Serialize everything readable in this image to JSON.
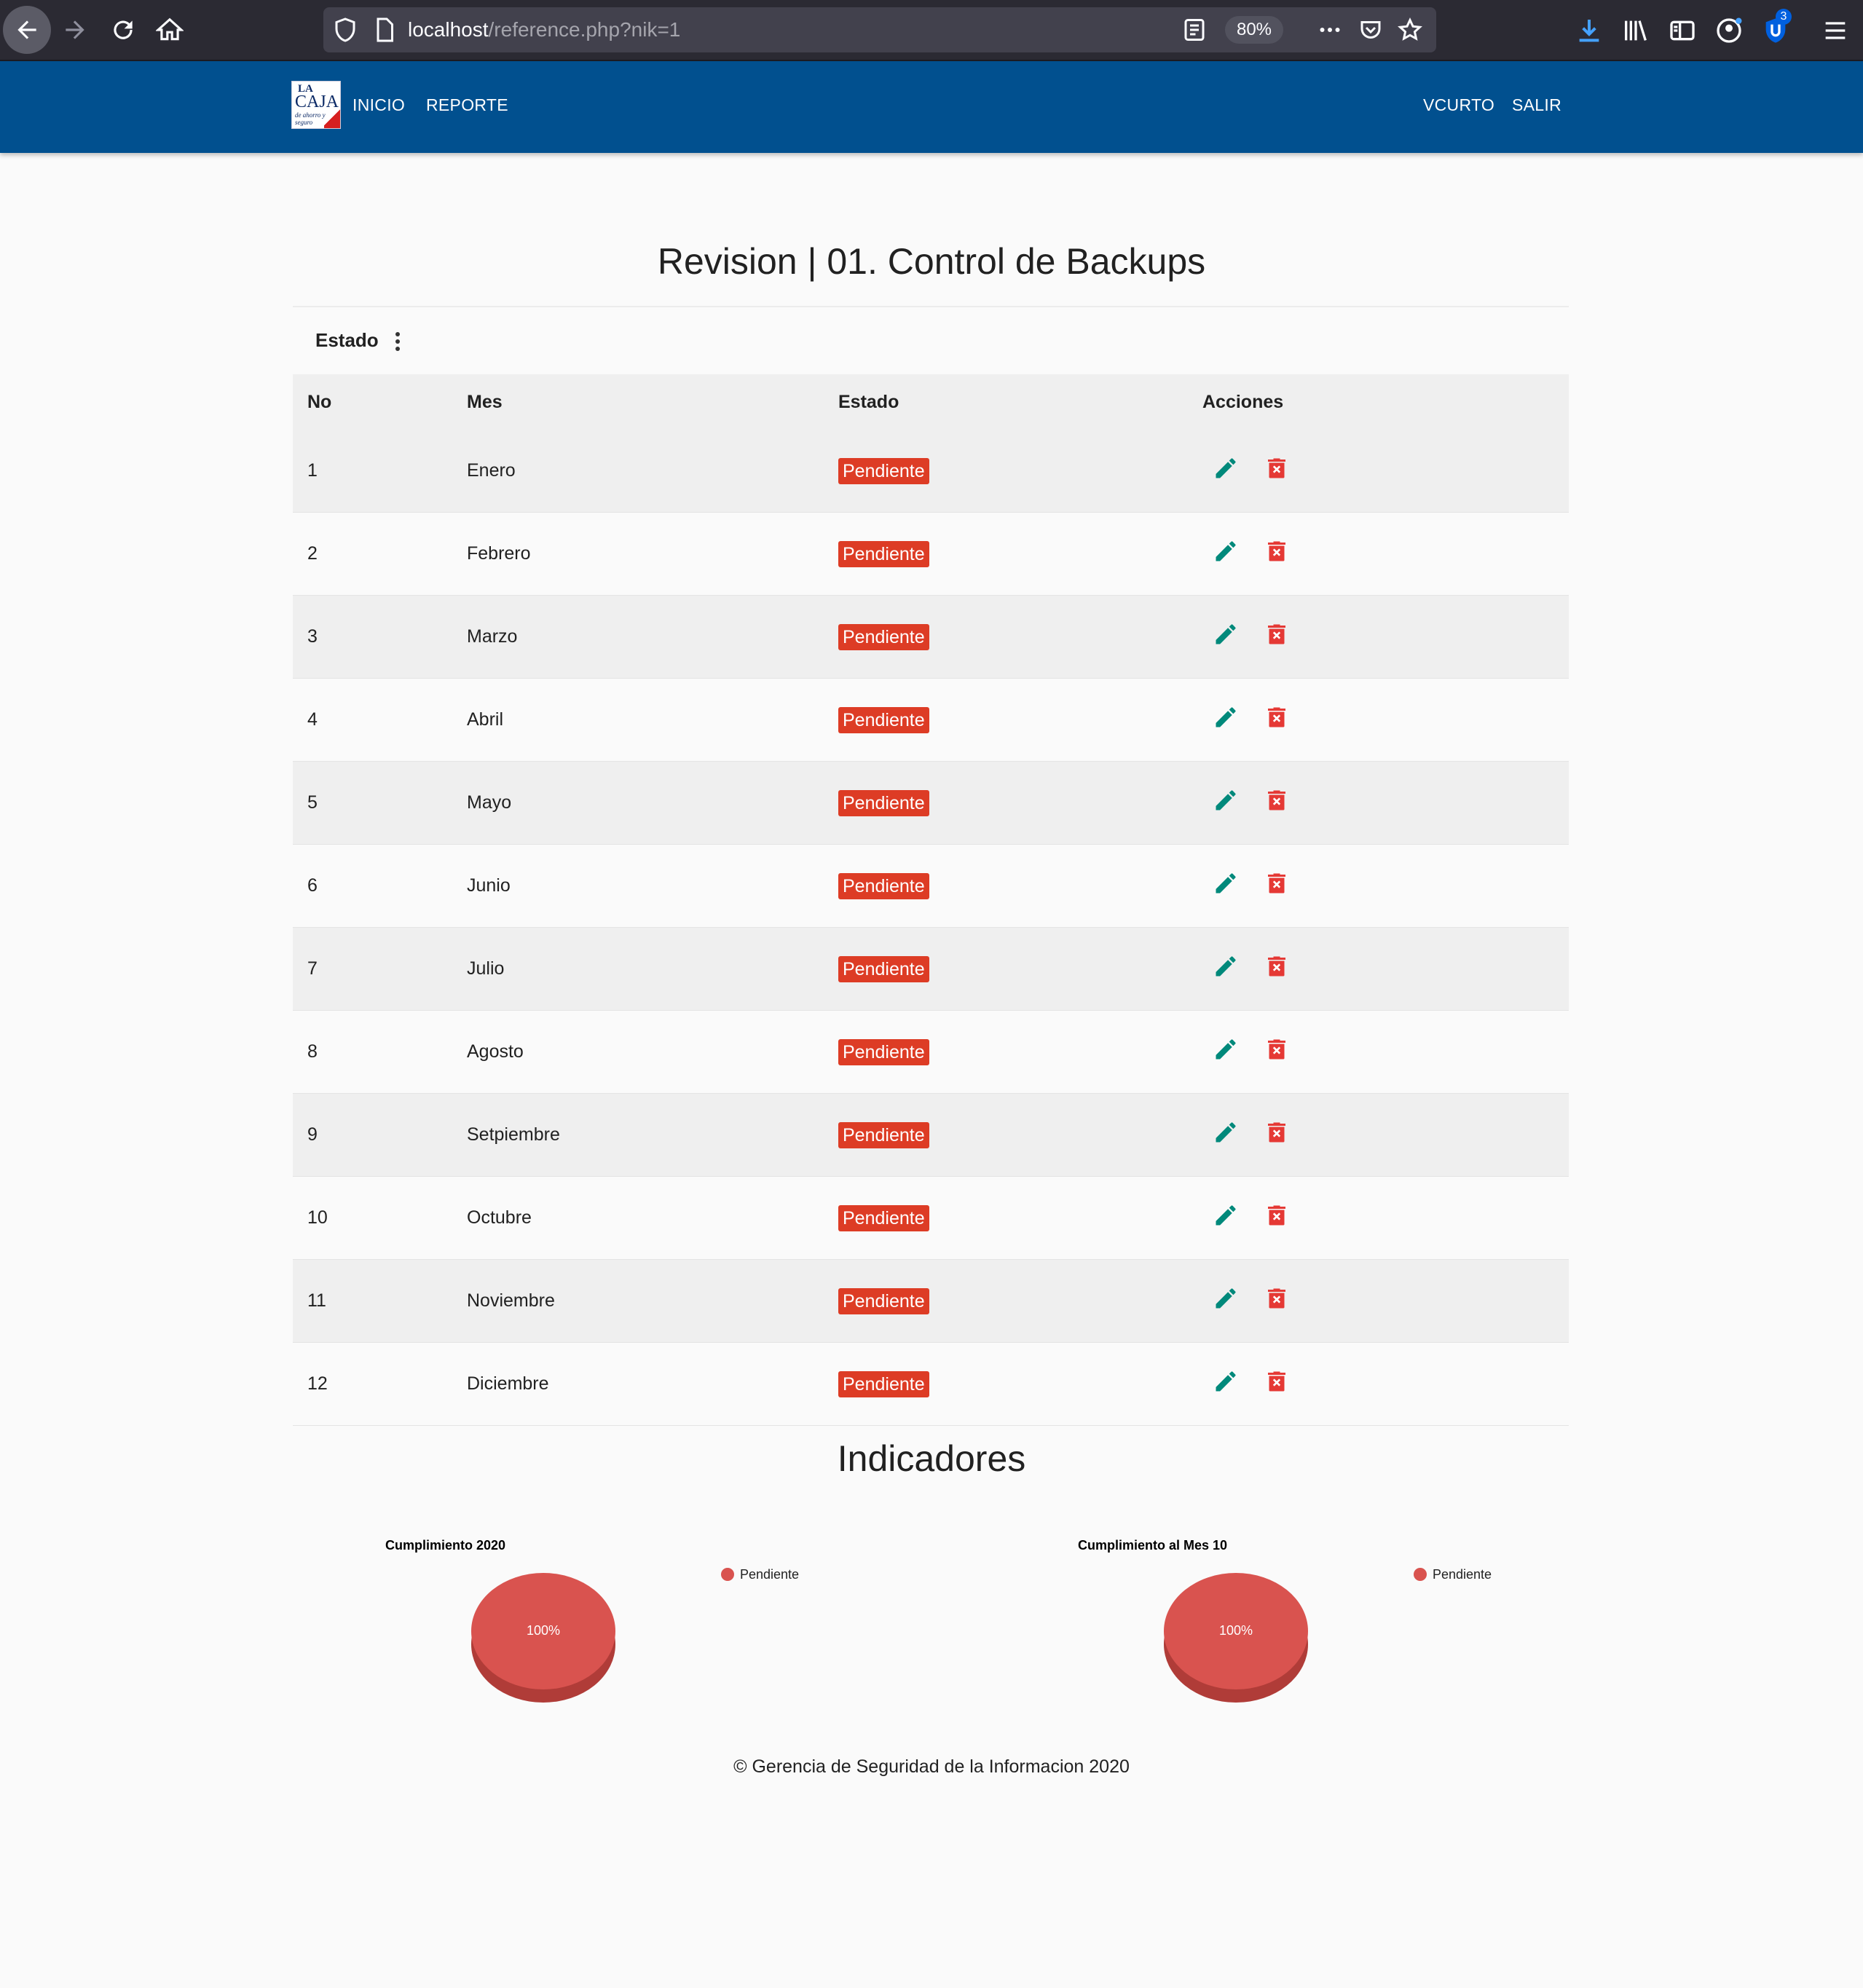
{
  "browser": {
    "url_host": "localhost",
    "url_path": "/reference.php?nik=1",
    "zoom": "80%",
    "notification_count": "3"
  },
  "nav": {
    "logo": {
      "line1": "LA",
      "line2": "CAJA",
      "line3": "de ahorro y seguro"
    },
    "links": [
      "INICIO",
      "REPORTE"
    ],
    "user": "VCURTO",
    "logout": "SALIR"
  },
  "page": {
    "title": "Revision | 01. Control de Backups",
    "filter_label": "Estado",
    "table": {
      "headers": [
        "No",
        "Mes",
        "Estado",
        "Acciones"
      ],
      "rows": [
        {
          "no": "1",
          "mes": "Enero",
          "estado": "Pendiente"
        },
        {
          "no": "2",
          "mes": "Febrero",
          "estado": "Pendiente"
        },
        {
          "no": "3",
          "mes": "Marzo",
          "estado": "Pendiente"
        },
        {
          "no": "4",
          "mes": "Abril",
          "estado": "Pendiente"
        },
        {
          "no": "5",
          "mes": "Mayo",
          "estado": "Pendiente"
        },
        {
          "no": "6",
          "mes": "Junio",
          "estado": "Pendiente"
        },
        {
          "no": "7",
          "mes": "Julio",
          "estado": "Pendiente"
        },
        {
          "no": "8",
          "mes": "Agosto",
          "estado": "Pendiente"
        },
        {
          "no": "9",
          "mes": "Setpiembre",
          "estado": "Pendiente"
        },
        {
          "no": "10",
          "mes": "Octubre",
          "estado": "Pendiente"
        },
        {
          "no": "11",
          "mes": "Noviembre",
          "estado": "Pendiente"
        },
        {
          "no": "12",
          "mes": "Diciembre",
          "estado": "Pendiente"
        }
      ]
    },
    "actions": {
      "edit_icon": "pencil-icon",
      "delete_icon": "trash-icon"
    },
    "indicators_title": "Indicadores",
    "footer": "© Gerencia de Seguridad de la Informacion 2020"
  },
  "colors": {
    "nav": "#01508f",
    "pendiente": "#dd3c25",
    "edit": "#00897b",
    "delete": "#e53935",
    "pie": "#d9534f"
  },
  "chart_data": [
    {
      "type": "pie",
      "title": "Cumplimiento 2020",
      "categories": [
        "Pendiente"
      ],
      "values": [
        100
      ],
      "data_labels": [
        "100%"
      ],
      "legend": "top-right"
    },
    {
      "type": "pie",
      "title": "Cumplimiento al Mes 10",
      "categories": [
        "Pendiente"
      ],
      "values": [
        100
      ],
      "data_labels": [
        "100%"
      ],
      "legend": "top-right"
    }
  ]
}
